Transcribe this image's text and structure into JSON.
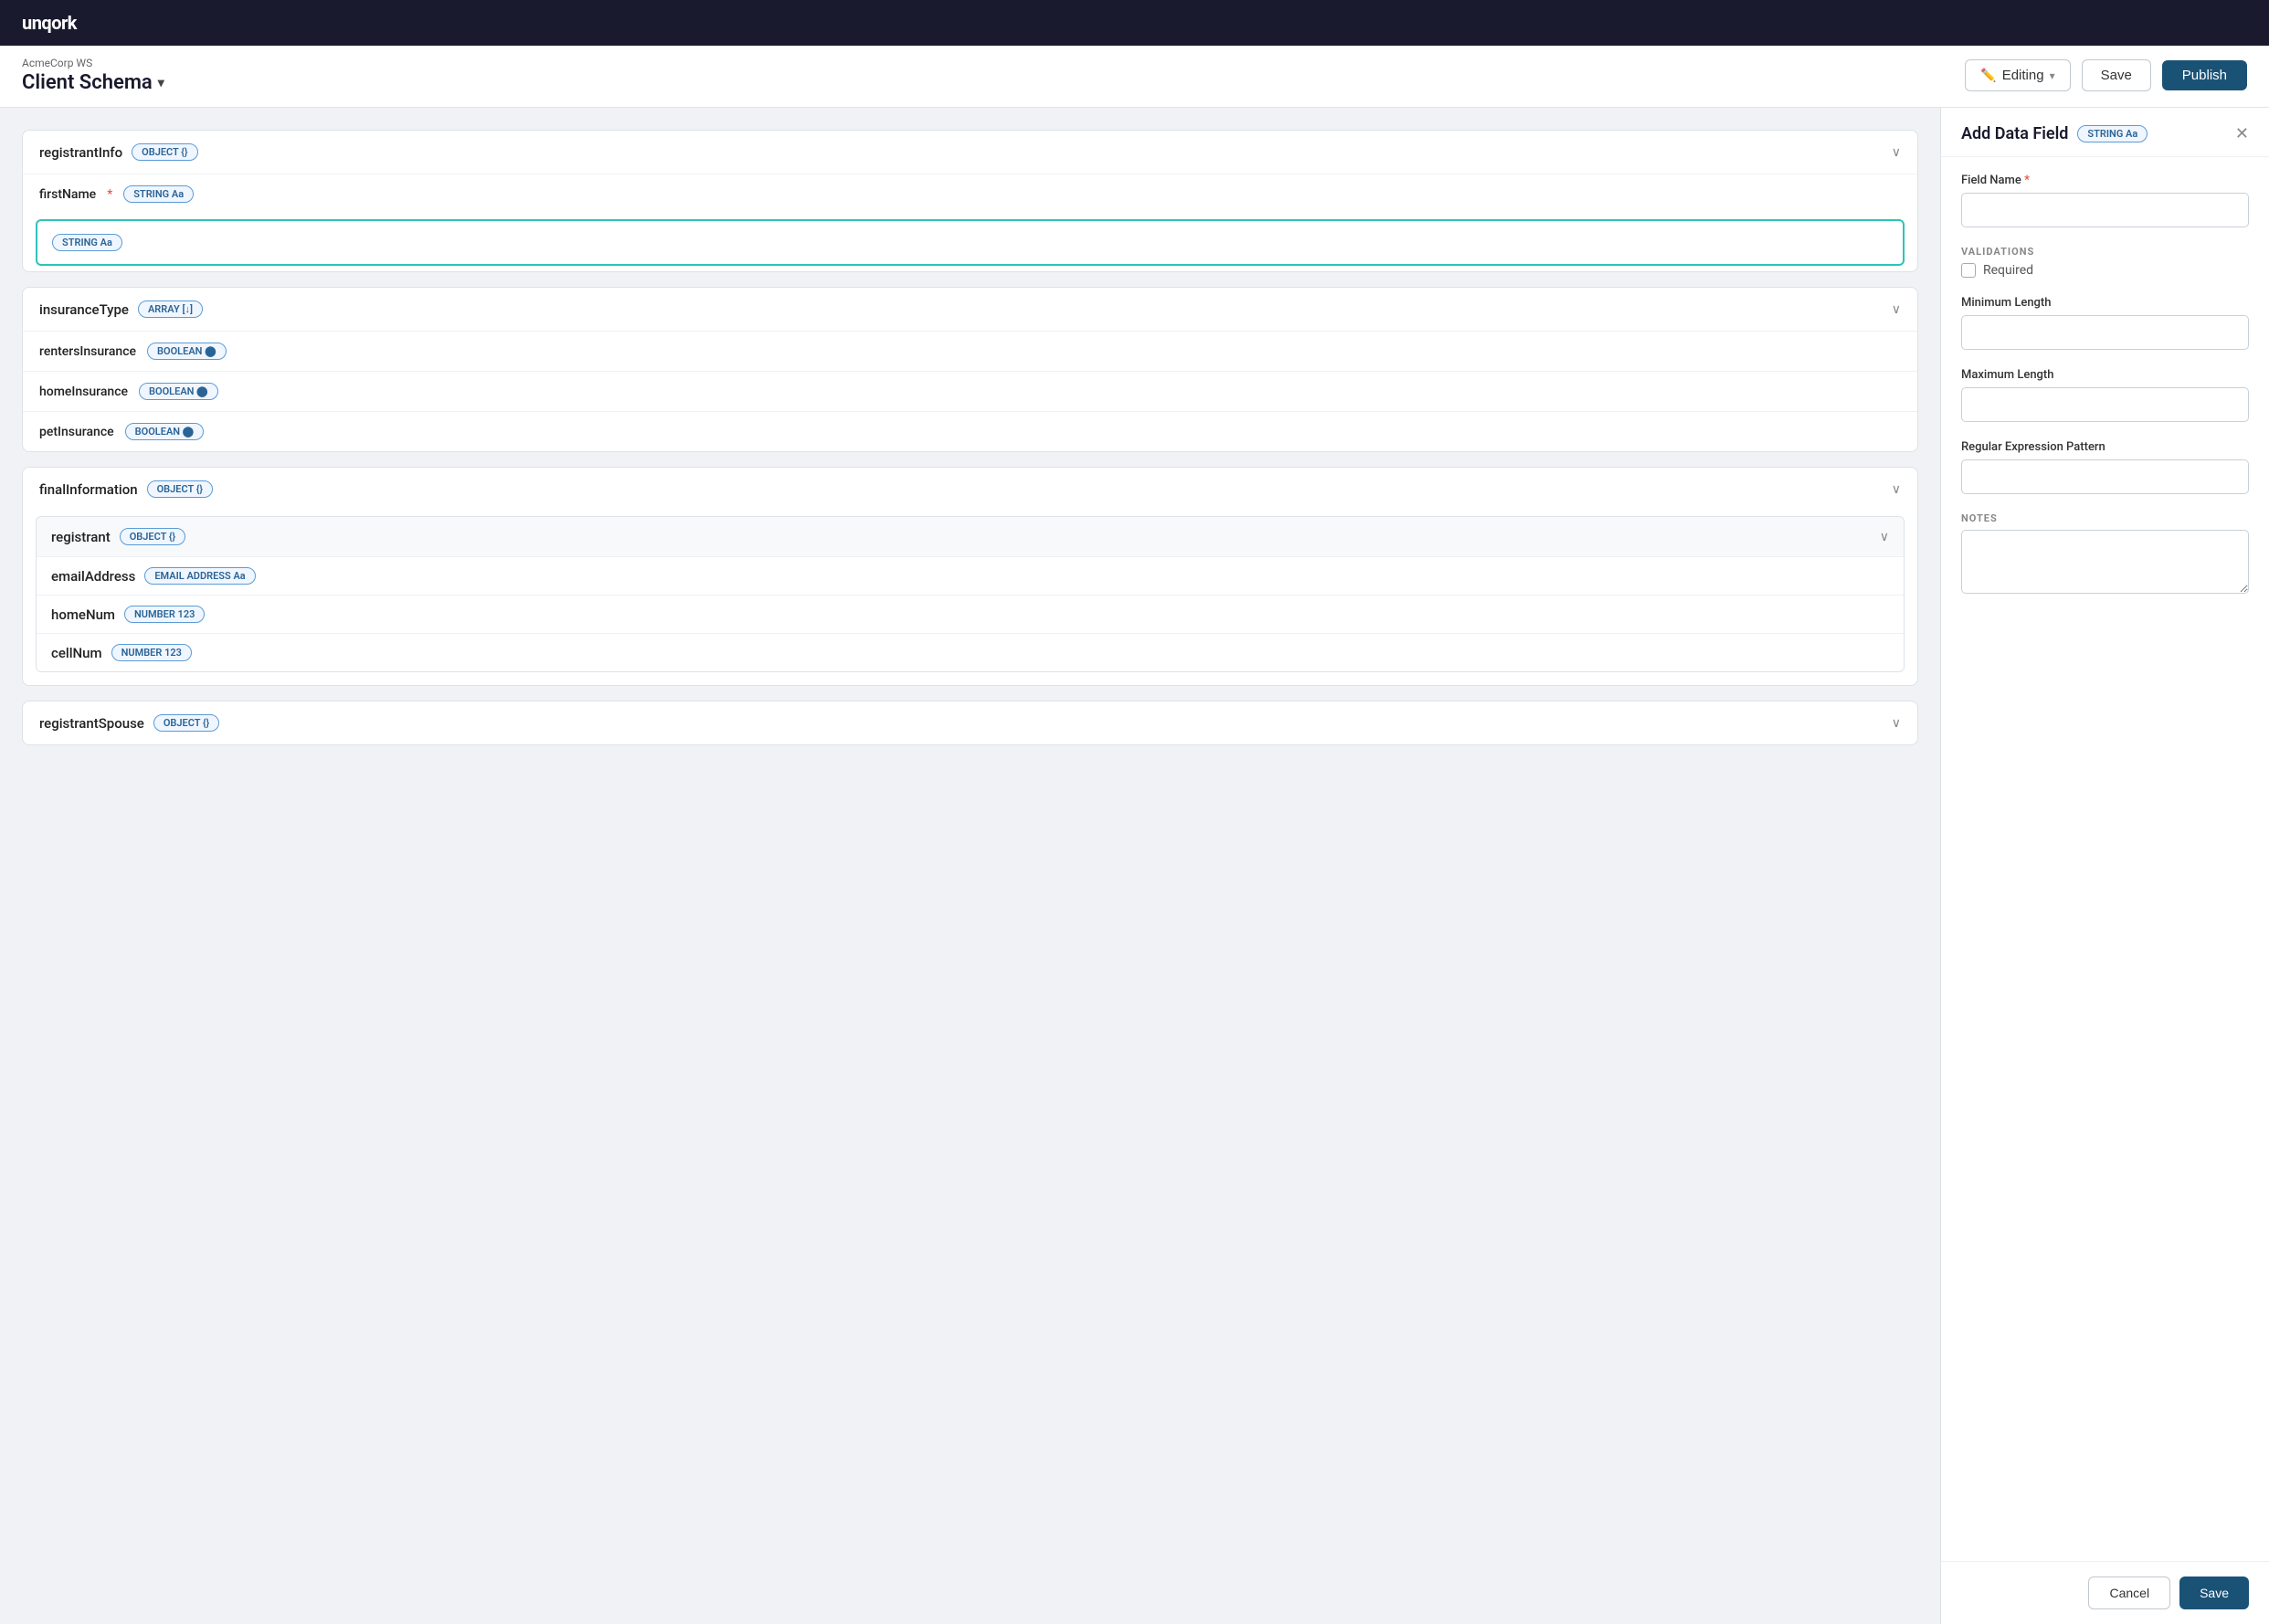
{
  "app": {
    "logo": "unqork"
  },
  "header": {
    "breadcrumb": "AcmeCorp WS",
    "title": "Client Schema",
    "chevron": "▾",
    "editing_label": "Editing",
    "save_label": "Save",
    "publish_label": "Publish"
  },
  "schema_blocks": [
    {
      "id": "registrantInfo",
      "name": "registrantInfo",
      "type_label": "OBJECT {}",
      "expanded": true,
      "fields": [
        {
          "name": "firstName",
          "required": true,
          "type_label": "STRING Aa",
          "active": true
        }
      ]
    },
    {
      "id": "insuranceType",
      "name": "insuranceType",
      "type_label": "ARRAY [↓]",
      "expanded": true,
      "fields": [
        {
          "name": "rentersInsurance",
          "type_label": "BOOLEAN ⬤",
          "required": false
        },
        {
          "name": "homeInsurance",
          "type_label": "BOOLEAN ⬤",
          "required": false
        },
        {
          "name": "petInsurance",
          "type_label": "BOOLEAN ⬤",
          "required": false
        }
      ]
    },
    {
      "id": "finalInformation",
      "name": "finalInformation",
      "type_label": "OBJECT {}",
      "expanded": true,
      "nested": {
        "name": "registrant",
        "type_label": "OBJECT {}",
        "fields": [
          {
            "name": "emailAddress",
            "type_label": "EMAIL ADDRESS Aa"
          },
          {
            "name": "homeNum",
            "type_label": "NUMBER 123"
          },
          {
            "name": "cellNum",
            "type_label": "NUMBER 123"
          }
        ]
      }
    },
    {
      "id": "registrantSpouse",
      "name": "registrantSpouse",
      "type_label": "OBJECT {}",
      "expanded": false,
      "fields": []
    }
  ],
  "add_data_field_panel": {
    "title": "Add Data Field",
    "type_badge": "STRING Aa",
    "field_name_label": "Field Name",
    "field_name_required": "*",
    "field_name_placeholder": "",
    "validations_section": "VALIDATIONS",
    "required_label": "Required",
    "min_length_label": "Minimum Length",
    "min_length_placeholder": "",
    "max_length_label": "Maximum Length",
    "max_length_placeholder": "",
    "regex_label": "Regular Expression Pattern",
    "regex_placeholder": "",
    "notes_section": "NOTES",
    "notes_placeholder": "",
    "cancel_label": "Cancel",
    "save_label": "Save"
  }
}
